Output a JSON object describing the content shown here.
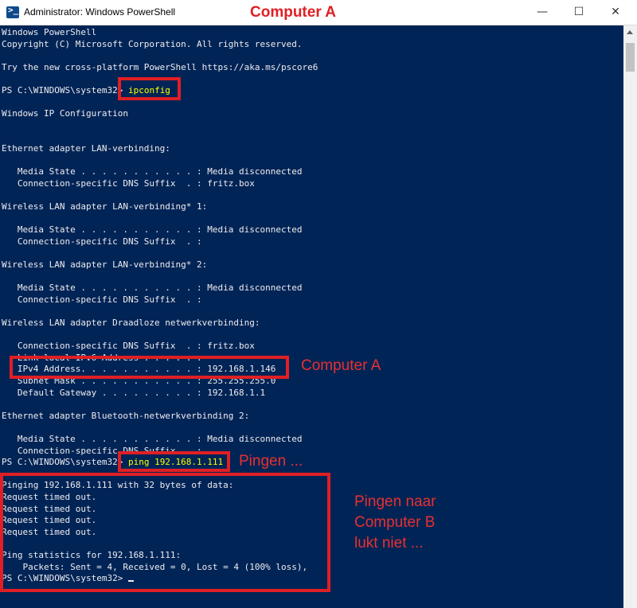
{
  "window": {
    "title": "Administrator: Windows PowerShell",
    "minimize": "—",
    "maximize": "☐",
    "close": "✕",
    "icon": "powershell-icon"
  },
  "annotations": {
    "heading": "Computer A",
    "ipv4_label": "Computer A",
    "ping_label": "Pingen ...",
    "result_label": "Pingen naar\nComputer B\nlukt niet ..."
  },
  "colors": {
    "console_bg": "#012456",
    "console_text": "#eeedf0",
    "command_text": "#ffff00",
    "annotation": "#e01f24"
  },
  "console": {
    "lines": [
      {
        "text": "Windows PowerShell"
      },
      {
        "text": "Copyright (C) Microsoft Corporation. All rights reserved."
      },
      {
        "text": ""
      },
      {
        "text": "Try the new cross-platform PowerShell https://aka.ms/pscore6"
      },
      {
        "text": ""
      },
      {
        "text": "PS C:\\WINDOWS\\system32> ",
        "cmd": "ipconfig"
      },
      {
        "text": ""
      },
      {
        "text": "Windows IP Configuration"
      },
      {
        "text": ""
      },
      {
        "text": ""
      },
      {
        "text": "Ethernet adapter LAN-verbinding:"
      },
      {
        "text": ""
      },
      {
        "text": "   Media State . . . . . . . . . . . : Media disconnected"
      },
      {
        "text": "   Connection-specific DNS Suffix  . : fritz.box"
      },
      {
        "text": ""
      },
      {
        "text": "Wireless LAN adapter LAN-verbinding* 1:"
      },
      {
        "text": ""
      },
      {
        "text": "   Media State . . . . . . . . . . . : Media disconnected"
      },
      {
        "text": "   Connection-specific DNS Suffix  . :"
      },
      {
        "text": ""
      },
      {
        "text": "Wireless LAN adapter LAN-verbinding* 2:"
      },
      {
        "text": ""
      },
      {
        "text": "   Media State . . . . . . . . . . . : Media disconnected"
      },
      {
        "text": "   Connection-specific DNS Suffix  . :"
      },
      {
        "text": ""
      },
      {
        "text": "Wireless LAN adapter Draadloze netwerkverbinding:"
      },
      {
        "text": ""
      },
      {
        "text": "   Connection-specific DNS Suffix  . : fritz.box"
      },
      {
        "text": "   Link-local IPv6 Address . . . . . :"
      },
      {
        "text": "   IPv4 Address. . . . . . . . . . . : 192.168.1.146"
      },
      {
        "text": "   Subnet Mask . . . . . . . . . . . : 255.255.255.0"
      },
      {
        "text": "   Default Gateway . . . . . . . . . : 192.168.1.1"
      },
      {
        "text": ""
      },
      {
        "text": "Ethernet adapter Bluetooth-netwerkverbinding 2:"
      },
      {
        "text": ""
      },
      {
        "text": "   Media State . . . . . . . . . . . : Media disconnected"
      },
      {
        "text": "   Connection-specific DNS Suffix  . :"
      },
      {
        "text": "PS C:\\WINDOWS\\system32> ",
        "cmd": "ping 192.168.1.111"
      },
      {
        "text": ""
      },
      {
        "text": "Pinging 192.168.1.111 with 32 bytes of data:"
      },
      {
        "text": "Request timed out."
      },
      {
        "text": "Request timed out."
      },
      {
        "text": "Request timed out."
      },
      {
        "text": "Request timed out."
      },
      {
        "text": ""
      },
      {
        "text": "Ping statistics for 192.168.1.111:"
      },
      {
        "text": "    Packets: Sent = 4, Received = 0, Lost = 4 (100% loss),"
      },
      {
        "text": "PS C:\\WINDOWS\\system32> ",
        "cursor": true
      }
    ]
  }
}
